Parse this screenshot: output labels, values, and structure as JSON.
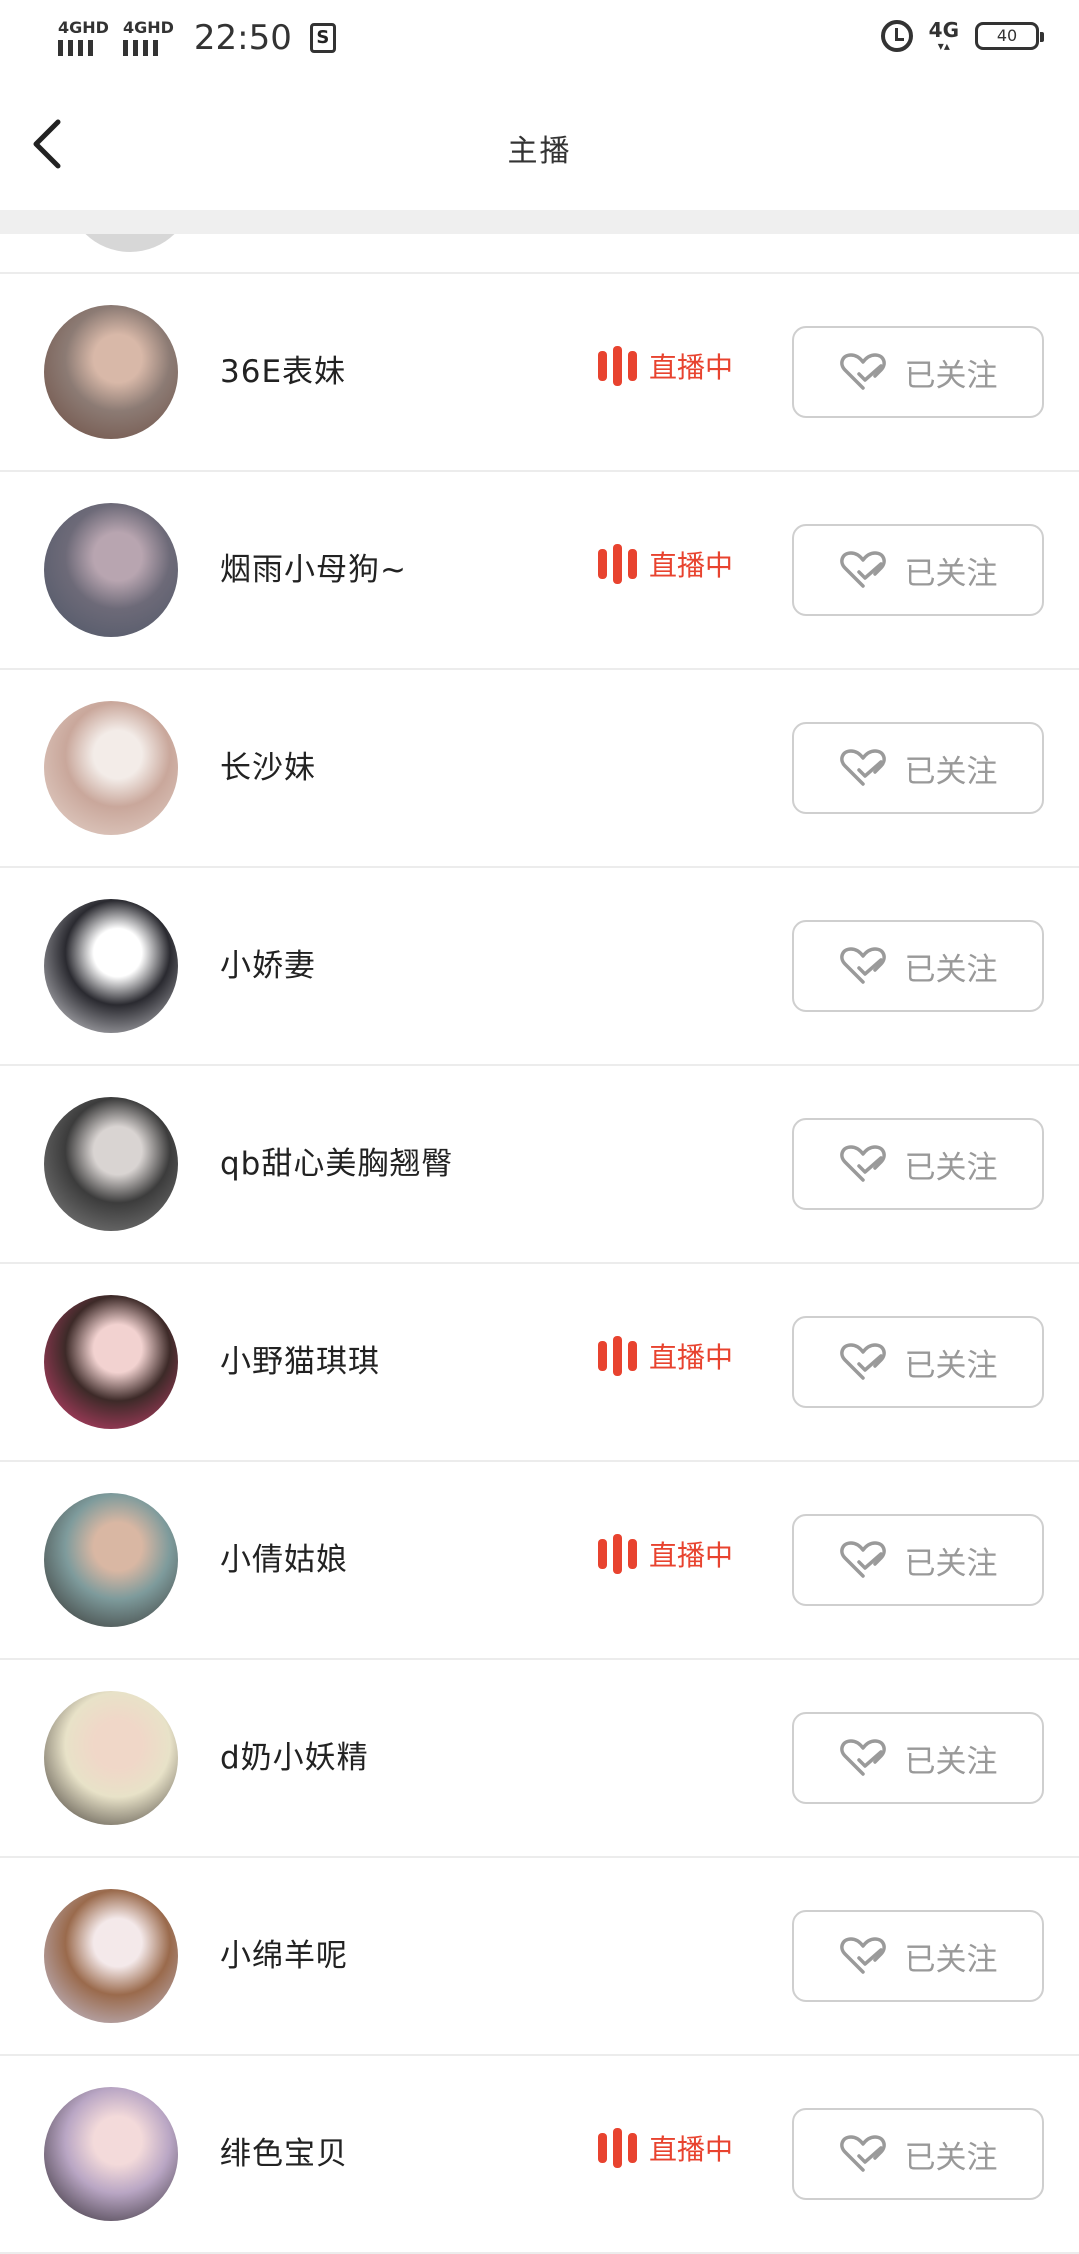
{
  "status_bar": {
    "signal1": "4GHD",
    "signal2": "4GHD",
    "time": "22:50",
    "net": "4G",
    "battery": "40"
  },
  "nav": {
    "title": "主播"
  },
  "anchors": [
    {
      "name": "36E表妹",
      "live": true,
      "live_label": "直播中",
      "follow_label": "已关注",
      "avatar_colors": [
        "#6b4a3f",
        "#d8b8a8",
        "#8c7b74"
      ]
    },
    {
      "name": "烟雨小母狗~",
      "live": true,
      "live_label": "直播中",
      "follow_label": "已关注",
      "avatar_colors": [
        "#4c5566",
        "#b8a5b0",
        "#6d6a78"
      ]
    },
    {
      "name": "长沙妹",
      "live": false,
      "live_label": "",
      "follow_label": "已关注",
      "avatar_colors": [
        "#e7d7cf",
        "#f3ece8",
        "#c9a79b"
      ]
    },
    {
      "name": "小娇妻",
      "live": false,
      "live_label": "",
      "follow_label": "已关注",
      "avatar_colors": [
        "#e8e8ec",
        "#ffffff",
        "#2a2a30"
      ]
    },
    {
      "name": "qb甜心美胸翘臀",
      "live": false,
      "live_label": "",
      "follow_label": "已关注",
      "avatar_colors": [
        "#8a8a8a",
        "#d9d4d2",
        "#3c3c3c"
      ]
    },
    {
      "name": "小野猫琪琪",
      "live": true,
      "live_label": "直播中",
      "follow_label": "已关注",
      "avatar_colors": [
        "#e0457a",
        "#f2d2d0",
        "#3d2a28"
      ]
    },
    {
      "name": "小倩姑娘",
      "live": true,
      "live_label": "直播中",
      "follow_label": "已关注",
      "avatar_colors": [
        "#2c2724",
        "#d9b7a3",
        "#7e9b9c"
      ]
    },
    {
      "name": "d奶小妖精",
      "live": false,
      "live_label": "",
      "follow_label": "已关注",
      "avatar_colors": [
        "#2b2522",
        "#f0d7c8",
        "#e8e2c8"
      ]
    },
    {
      "name": "小绵羊呢",
      "live": false,
      "live_label": "",
      "follow_label": "已关注",
      "avatar_colors": [
        "#c9cde8",
        "#f4e9ea",
        "#9a6a4c"
      ]
    },
    {
      "name": "绯色宝贝",
      "live": true,
      "live_label": "直播中",
      "follow_label": "已关注",
      "avatar_colors": [
        "#1f1a1e",
        "#f3dada",
        "#b9a6c4"
      ]
    }
  ],
  "colors": {
    "live": "#e8432f",
    "follow_border": "#cfcfcf",
    "follow_text": "#999999",
    "divider": "#ececec"
  },
  "icons": {
    "back": "chevron-left-icon",
    "live": "live-bars-icon",
    "follow": "heart-check-icon"
  }
}
